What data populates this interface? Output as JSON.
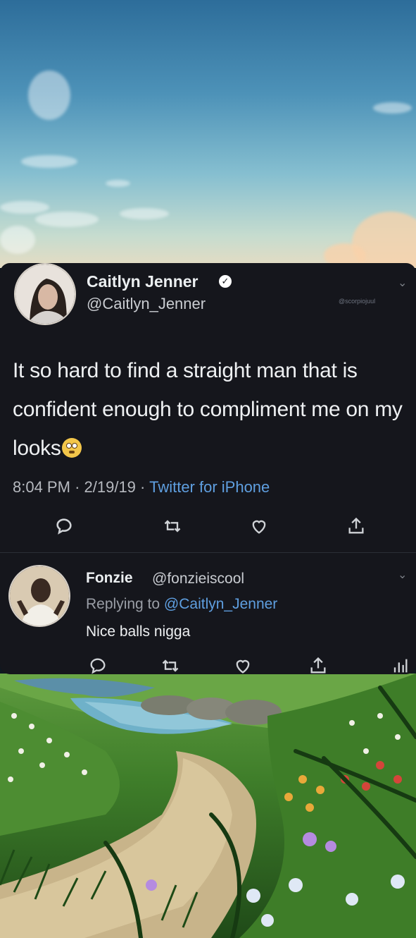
{
  "tweet": {
    "author_name": "Caitlyn Jenner",
    "author_handle": "@Caitlyn_Jenner",
    "watermark": "@scorpiojuul",
    "text": "It so hard to find a straight man that is confident enough to compliment me on my looks",
    "time": "8:04 PM",
    "date": "2/19/19",
    "source": "Twitter for iPhone",
    "actions": [
      "reply-icon",
      "retweet-icon",
      "like-icon",
      "share-icon"
    ]
  },
  "reply": {
    "author_name": "Fonzie",
    "author_handle": "@fonzieiscool",
    "replying_prefix": "Replying to ",
    "replying_to": "@Caitlyn_Jenner",
    "text": "Nice balls nigga",
    "actions": [
      "reply-icon",
      "retweet-icon",
      "like-icon",
      "share-icon",
      "analytics-icon"
    ]
  },
  "colors": {
    "card_background": "#15161c",
    "link_blue": "#5f9fe0",
    "text_primary": "#eef0f2",
    "text_secondary": "#b6b9bf"
  }
}
